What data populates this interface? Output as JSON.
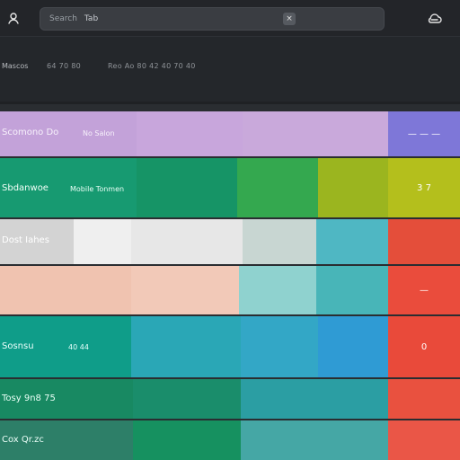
{
  "top": {
    "search_label": "Search",
    "search_value": "Tab",
    "left_icon": "profile-icon",
    "right_icon": "cloud-icon"
  },
  "subheader": {
    "title": "Mascos",
    "meta_a": "64 70 80",
    "meta_b": "Reo Ao 80 42 40 70 40"
  },
  "rows": [
    {
      "label": "Scomono Do",
      "sub": "No Salon",
      "side": "— — —"
    },
    {
      "label": "Sbdanwoe",
      "sub": "Mobile Tonmen",
      "side": "3 7"
    },
    {
      "label": "Dost Iahes",
      "sub": "",
      "side": ""
    },
    {
      "label": "",
      "sub": "",
      "side": "—"
    },
    {
      "label": "Sosnsu",
      "sub": "40 44",
      "side": "0"
    },
    {
      "label": "Tosy 9n8 75",
      "sub": "",
      "side": ""
    },
    {
      "label": "Cox Qr.zc",
      "sub": "",
      "side": ""
    }
  ],
  "colors": {
    "accent_red": "#e74c3c",
    "teal": "#16a085",
    "green": "#1e8f68",
    "blue": "#2e9cca",
    "lavender": "#c5a3d8",
    "peach": "#f1c8b7"
  }
}
